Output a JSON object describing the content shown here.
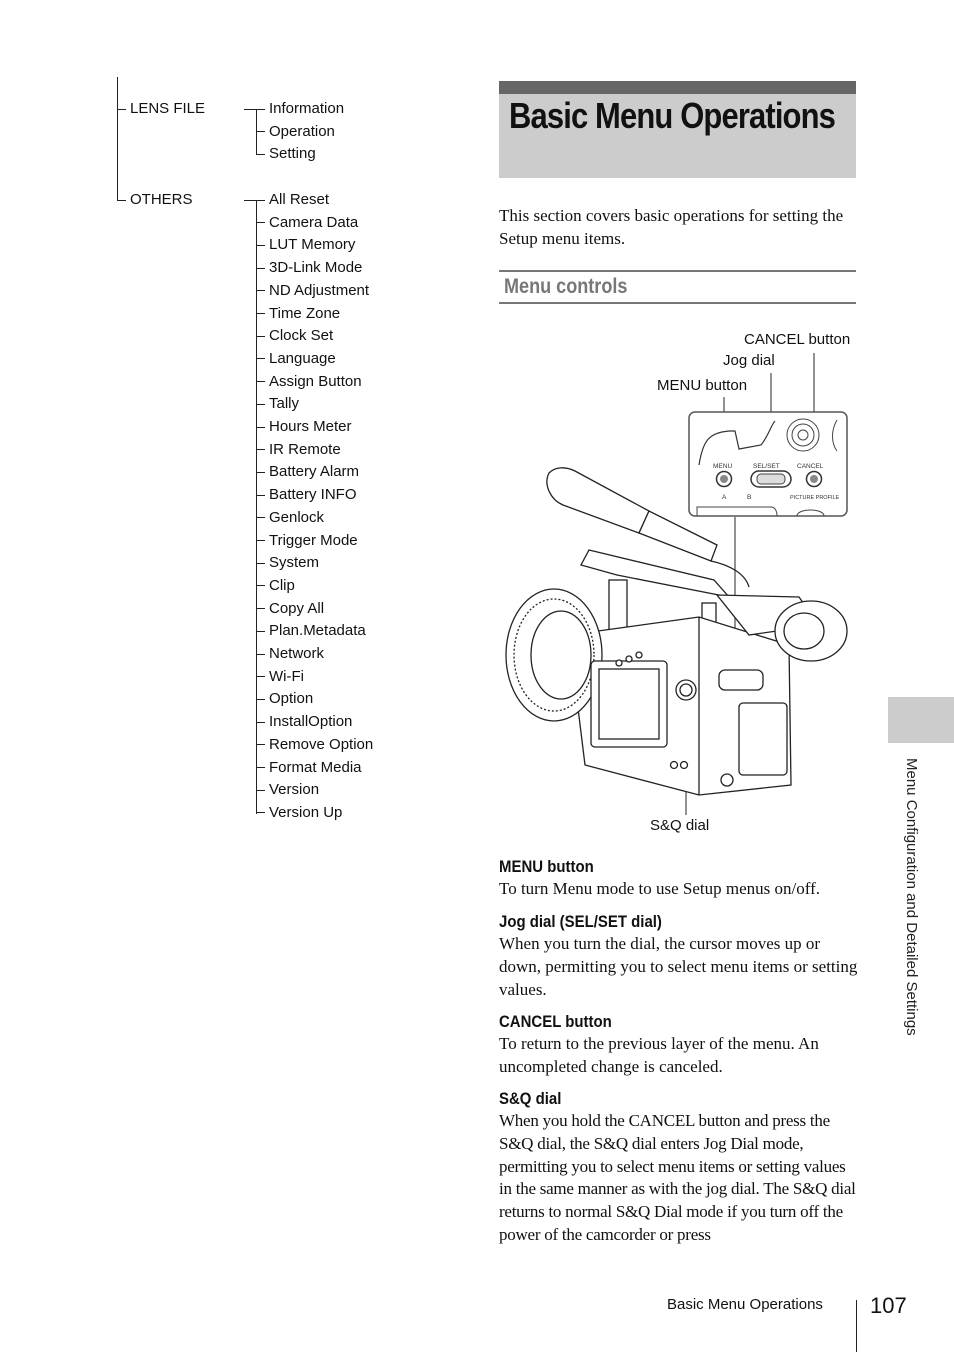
{
  "menu_tree": {
    "groups": [
      {
        "label": "LENS FILE",
        "items": [
          "Information",
          "Operation",
          "Setting"
        ]
      },
      {
        "label": "OTHERS",
        "items": [
          "All Reset",
          "Camera Data",
          "LUT Memory",
          "3D-Link Mode",
          "ND Adjustment",
          "Time Zone",
          "Clock Set",
          "Language",
          "Assign Button",
          "Tally",
          "Hours Meter",
          "IR Remote",
          "Battery Alarm",
          "Battery INFO",
          "Genlock",
          "Trigger Mode",
          "System",
          "Clip",
          "Copy All",
          "Plan.Metadata",
          "Network",
          "Wi-Fi",
          "Option",
          "InstallOption",
          "Remove Option",
          "Format Media",
          "Version",
          "Version Up"
        ]
      }
    ]
  },
  "title": "Basic Menu Operations",
  "intro": "This section covers basic operations for setting the Setup menu items.",
  "section_heading": "Menu controls",
  "figure": {
    "callouts": {
      "cancel": "CANCEL button",
      "jog": "Jog dial",
      "menu": "MENU button",
      "sq": "S&Q dial"
    },
    "panel_labels": {
      "menu": "MENU",
      "selset": "SEL/SET",
      "cancel": "CANCEL",
      "a": "A",
      "b": "B",
      "picture_profile": "PICTURE PROFILE"
    }
  },
  "descriptions": [
    {
      "heading": "MENU button",
      "body": "To turn Menu mode to use Setup menus on/off."
    },
    {
      "heading": "Jog dial (SEL/SET dial)",
      "body": "When you turn the dial, the cursor moves up or down, permitting you to select menu items or setting values."
    },
    {
      "heading": "CANCEL button",
      "body": "To return to the previous layer of the menu. An uncompleted change is canceled."
    },
    {
      "heading": "S&Q dial",
      "body": "When you hold the CANCEL button and press the S&Q dial, the S&Q dial enters Jog Dial mode, permitting you to select menu items or setting values in the same manner as with the jog dial. The S&Q dial returns to normal S&Q Dial mode if you turn off the power of the camcorder or press"
    }
  ],
  "side_tab_label": "Menu Configuration and Detailed Settings",
  "footer": {
    "section": "Basic Menu Operations",
    "page_number": "107"
  },
  "colors": {
    "title_band": "#cccccc",
    "title_bar": "#666666",
    "section_heading": "#777777"
  }
}
